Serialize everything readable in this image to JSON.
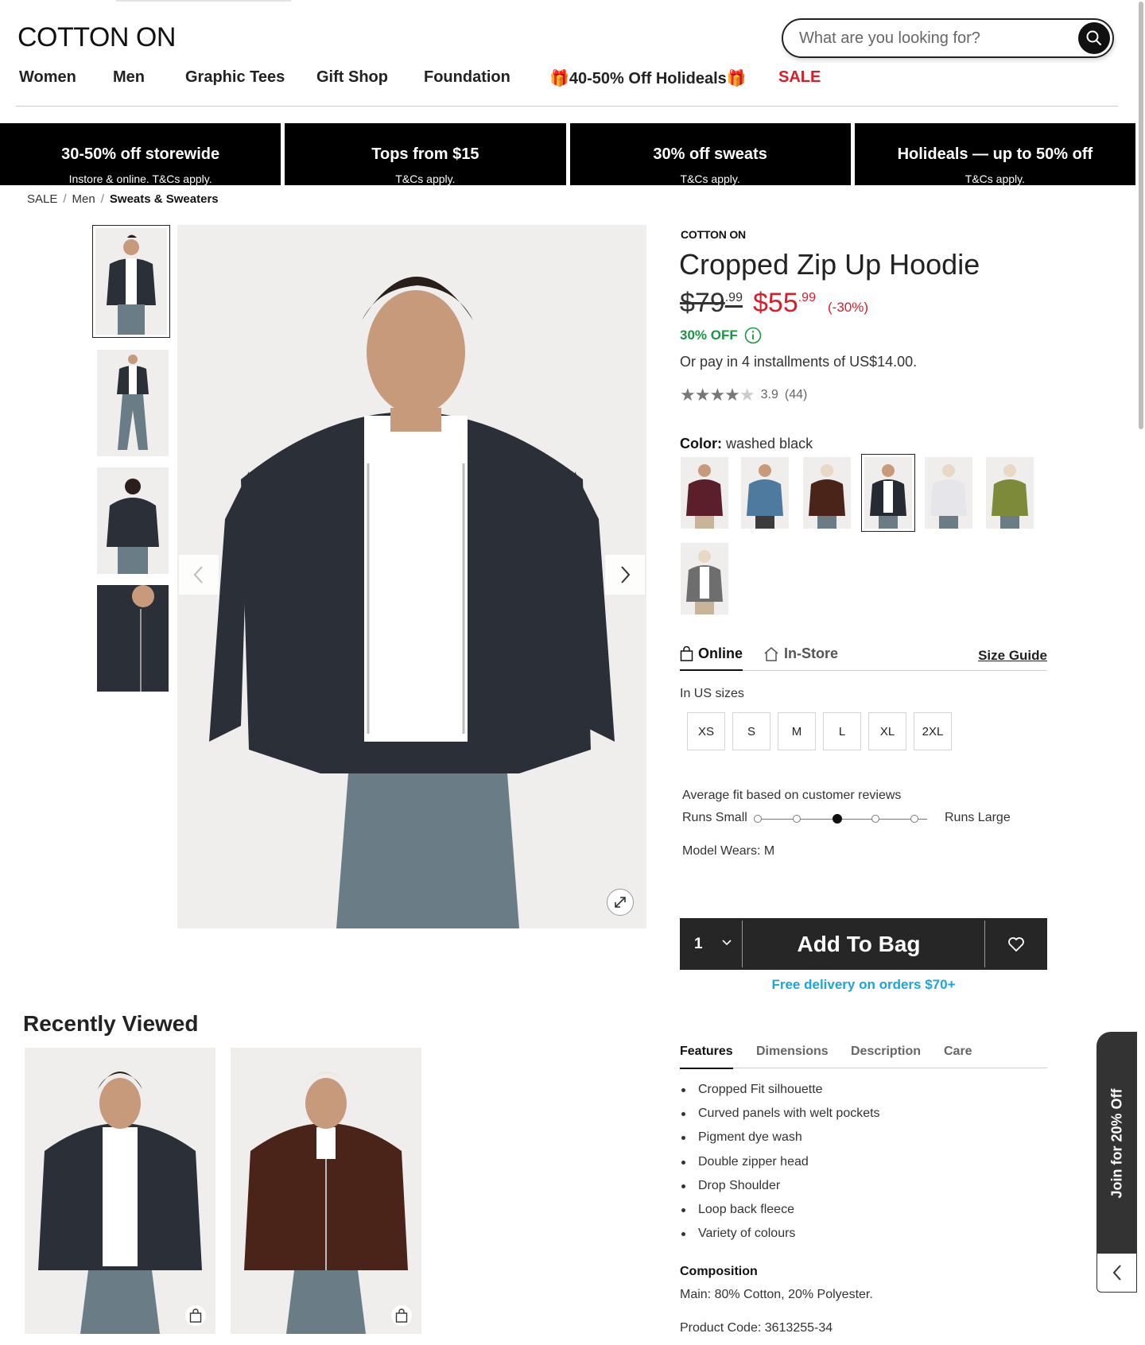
{
  "header": {
    "logo": "COTTON ON",
    "search_placeholder": "What are you looking for?"
  },
  "nav": {
    "items": [
      "Women",
      "Men",
      "Graphic Tees",
      "Gift Shop",
      "Foundation",
      "🎁40-50% Off Holideals🎁",
      "SALE"
    ]
  },
  "promos": [
    {
      "title": "30-50% off storewide",
      "sub": "Instore & online. T&Cs apply."
    },
    {
      "title": "Tops from $15",
      "sub": "T&Cs apply."
    },
    {
      "title": "30% off sweats",
      "sub": "T&Cs apply."
    },
    {
      "title": "Holideals — up to 50% off",
      "sub": "T&Cs apply."
    }
  ],
  "breadcrumb": [
    "SALE",
    "Men",
    "Sweats & Sweaters"
  ],
  "product": {
    "brand": "COTTON ON",
    "title": "Cropped Zip Up Hoodie",
    "old_price": "$79",
    "old_price_cents": ".99",
    "new_price": "$55",
    "new_price_cents": ".99",
    "discount_pct": "(-30%)",
    "off_label": "30% OFF",
    "installments": "Or pay in 4 installments of US$14.00.",
    "rating_value": 3.9,
    "rating": "3.9",
    "reviews": "(44)",
    "color_label": "Color:",
    "color_value": "washed black",
    "swatch_colors": [
      "#5b1f2c",
      "#4f7aa0",
      "#4a2418",
      "#262b33",
      "#e6e6ea",
      "#7c8a3a",
      "#6e6e6e"
    ],
    "selected_swatch": 3
  },
  "availability": {
    "online": "Online",
    "instore": "In-Store",
    "size_guide": "Size Guide",
    "sizes_label": "In US sizes",
    "sizes": [
      "XS",
      "S",
      "M",
      "L",
      "XL",
      "2XL"
    ]
  },
  "fit": {
    "title": "Average fit based on customer reviews",
    "small": "Runs Small",
    "large": "Runs Large",
    "position": 3,
    "positions": 5,
    "model": "Model Wears: M"
  },
  "bag": {
    "qty": "1",
    "add": "Add To Bag",
    "free_delivery": "Free delivery on orders $70+"
  },
  "recent": {
    "title": "Recently Viewed"
  },
  "details": {
    "tabs": [
      "Features",
      "Dimensions",
      "Description",
      "Care"
    ],
    "features": [
      "Cropped Fit silhouette",
      "Curved panels with welt pockets",
      "Pigment dye wash",
      "Double zipper head",
      "Drop Shoulder",
      "Loop back fleece",
      "Variety of colours"
    ],
    "composition_title": "Composition",
    "composition": "Main: 80% Cotton, 20% Polyester.",
    "product_code": "Product Code: 3613255-34"
  },
  "join": "Join for 20% Off",
  "colors": {
    "sale_red": "#d81e2b",
    "off_green": "#1a9642",
    "delivery_blue": "#1aa6d8",
    "bag_bar": "#262626",
    "hoodie": "#2a2f38",
    "tee": "#ffffff",
    "jeans": "#6a7d86"
  }
}
